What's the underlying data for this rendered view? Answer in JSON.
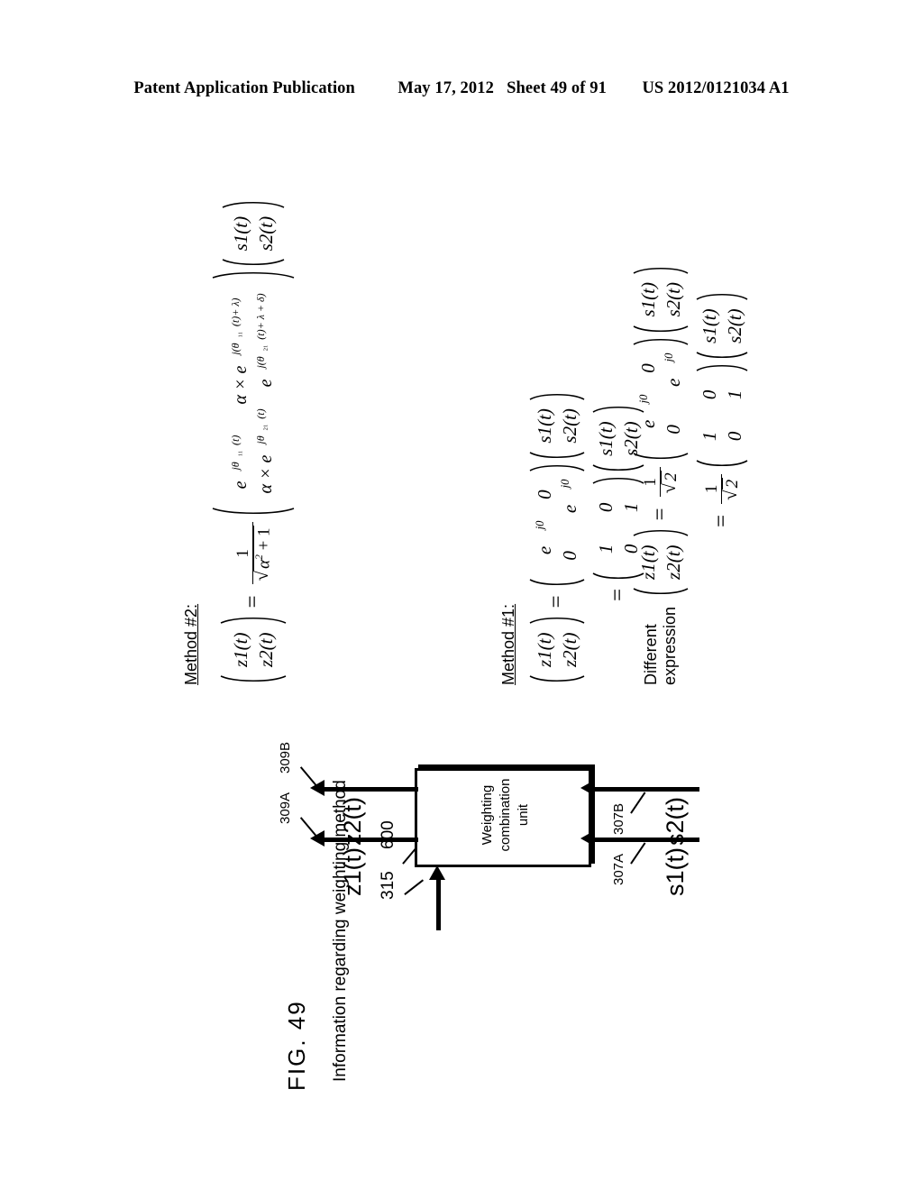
{
  "header": {
    "publication": "Patent Application Publication",
    "date": "May 17, 2012",
    "sheet": "Sheet 49 of 91",
    "docnum": "US 2012/0121034 A1"
  },
  "figure": {
    "title": "FIG. 49",
    "control_label": "Information regarding weighting method",
    "block": {
      "line1": "Weighting",
      "line2": "combination",
      "line3": "unit",
      "ref": "600"
    },
    "control_ref": "315",
    "inputs": [
      {
        "label": "s1(t)",
        "ref": "307A"
      },
      {
        "label": "s2(t)",
        "ref": "307B"
      }
    ],
    "outputs": [
      {
        "label": "z1(t)",
        "ref": "309A"
      },
      {
        "label": "z2(t)",
        "ref": "309B"
      }
    ]
  },
  "equations": {
    "method1": {
      "title": "Method #1:",
      "lhs": {
        "row1": "z1(t)",
        "row2": "z2(t)"
      },
      "matrix1": {
        "a11": "e",
        "a11_exp": "j0",
        "a12": "0",
        "a21": "0",
        "a22": "e",
        "a22_exp": "j0"
      },
      "vector": {
        "row1": "s1(t)",
        "row2": "s2(t)"
      },
      "matrix2": {
        "a11": "1",
        "a12": "0",
        "a21": "0",
        "a22": "1"
      },
      "eq": "=",
      "eq2": "="
    },
    "different": {
      "title_line1": "Different",
      "title_line2": "expression",
      "lhs": {
        "row1": "z1(t)",
        "row2": "z2(t)"
      },
      "scalar_num": "1",
      "scalar_den_radical": "2",
      "matrix1": {
        "a11": "e",
        "a11_exp": "j0",
        "a12": "0",
        "a21": "0",
        "a22": "e",
        "a22_exp": "j0"
      },
      "vector": {
        "row1": "s1(t)",
        "row2": "s2(t)"
      },
      "matrix2": {
        "a11": "1",
        "a12": "0",
        "a21": "0",
        "a22": "1"
      },
      "eq": "=",
      "eq2": "="
    },
    "method2": {
      "title": "Method #2:",
      "lhs": {
        "row1": "z1(t)",
        "row2": "z2(t)"
      },
      "eq": "=",
      "scalar_num": "1",
      "scalar_den_radical": "α",
      "scalar_den_exp": "2",
      "scalar_den_tail": "+ 1",
      "matrix": {
        "a11_base": "e",
        "a11_exp": "jθ",
        "a11_sub": "11",
        "a11_arg": "(t)",
        "a12_alpha": "α × e",
        "a12_exp": "j(θ",
        "a12_sub": "11",
        "a12_arg": "(t)+ λ)",
        "a21_alpha": "α × e",
        "a21_exp": "jθ",
        "a21_sub": "21",
        "a21_arg": "(t)",
        "a22_base": "e",
        "a22_exp": "j(θ",
        "a22_sub": "21",
        "a22_arg": "(t)+ λ + δ)"
      },
      "vector": {
        "row1": "s1(t)",
        "row2": "s2(t)"
      }
    }
  }
}
